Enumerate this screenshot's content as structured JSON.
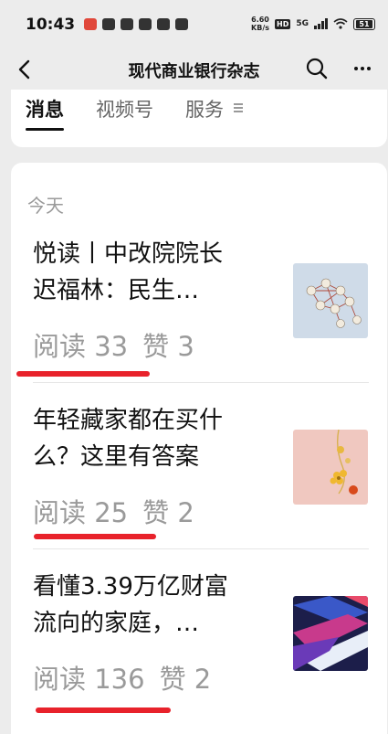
{
  "status_bar": {
    "time": "10:43",
    "net_speed_value": "6.60",
    "net_speed_unit": "KB/s",
    "hd_label": "HD",
    "signal_label": "5G",
    "battery": "51"
  },
  "nav": {
    "title": "现代商业银行杂志"
  },
  "tabs": [
    {
      "label": "消息",
      "active": true
    },
    {
      "label": "视频号",
      "active": false
    },
    {
      "label": "服务",
      "active": false
    }
  ],
  "feed": {
    "section_label": "今天",
    "articles": [
      {
        "title_line1": "悦读丨中改院院长",
        "title_line2": "迟福林：民生…",
        "reads": "阅读 33",
        "likes": "赞 3"
      },
      {
        "title_line1": "年轻藏家都在买什",
        "title_line2": "么？这里有答案",
        "reads": "阅读 25",
        "likes": "赞 2"
      },
      {
        "title_line1": "看懂3.39万亿财富",
        "title_line2": "流向的家庭，…",
        "reads": "阅读 136",
        "likes": "赞 2"
      }
    ]
  },
  "colors": {
    "annotation_red": "#e8222b",
    "background": "#ececec"
  }
}
